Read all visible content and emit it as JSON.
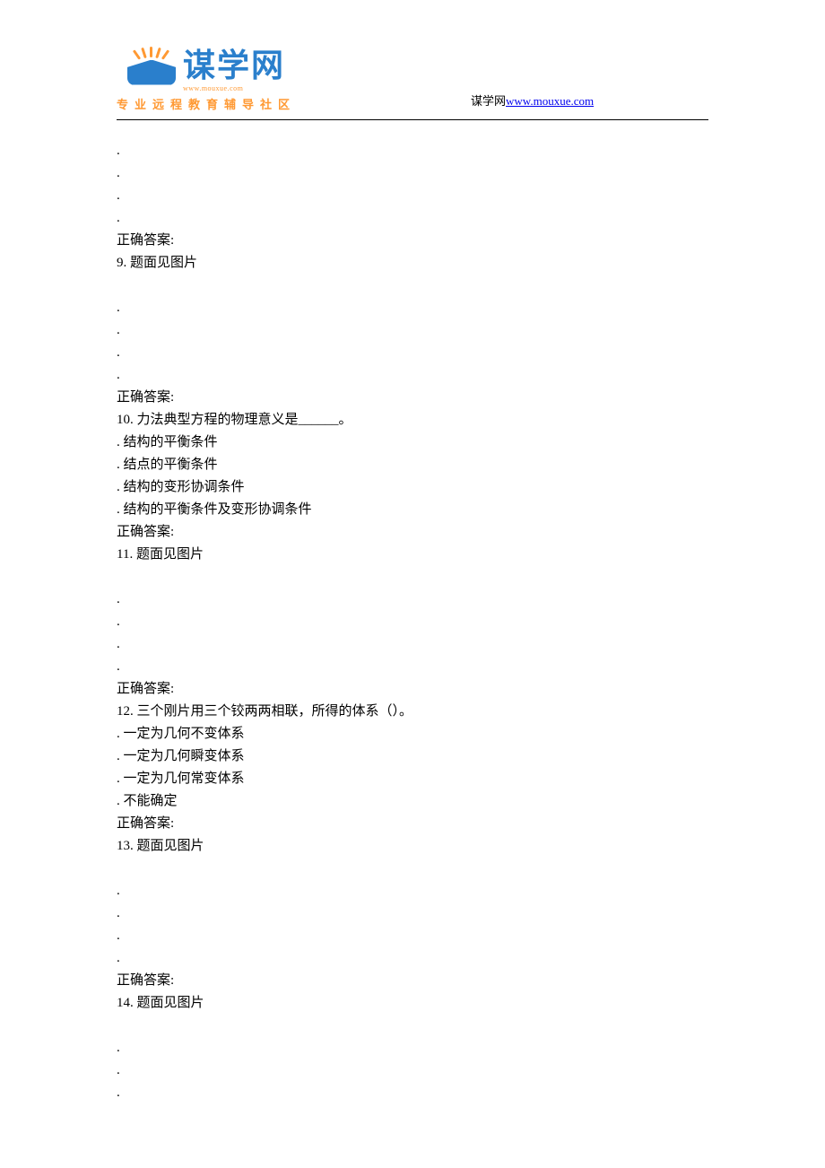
{
  "header": {
    "logo_text": "谋学网",
    "logo_url": "www.mouxue.com",
    "logo_subtitle": "专业远程教育辅导社区",
    "right_text": "谋学网",
    "right_link": "www.mouxue.com"
  },
  "items": [
    {
      "type": "dot",
      "text": "."
    },
    {
      "type": "dot",
      "text": "."
    },
    {
      "type": "dot",
      "text": "."
    },
    {
      "type": "dot",
      "text": "."
    },
    {
      "type": "answer",
      "text": "正确答案:"
    },
    {
      "type": "question",
      "text": "9.   题面见图片"
    },
    {
      "type": "blank",
      "text": ""
    },
    {
      "type": "dot",
      "text": "."
    },
    {
      "type": "dot",
      "text": "."
    },
    {
      "type": "dot",
      "text": "."
    },
    {
      "type": "dot",
      "text": "."
    },
    {
      "type": "answer",
      "text": "正确答案:"
    },
    {
      "type": "question",
      "text": "10.   力法典型方程的物理意义是______。"
    },
    {
      "type": "option",
      "text": ".  结构的平衡条件"
    },
    {
      "type": "option",
      "text": ".  结点的平衡条件"
    },
    {
      "type": "option",
      "text": ".  结构的变形协调条件"
    },
    {
      "type": "option",
      "text": ".  结构的平衡条件及变形协调条件"
    },
    {
      "type": "answer",
      "text": "正确答案:"
    },
    {
      "type": "question",
      "text": "11.   题面见图片"
    },
    {
      "type": "blank",
      "text": ""
    },
    {
      "type": "dot",
      "text": "."
    },
    {
      "type": "dot",
      "text": "."
    },
    {
      "type": "dot",
      "text": "."
    },
    {
      "type": "dot",
      "text": "."
    },
    {
      "type": "answer",
      "text": "正确答案:"
    },
    {
      "type": "question",
      "text": "12.   三个刚片用三个铰两两相联，所得的体系（）。"
    },
    {
      "type": "option",
      "text": ".  一定为几何不变体系"
    },
    {
      "type": "option",
      "text": ".  一定为几何瞬变体系"
    },
    {
      "type": "option",
      "text": ".  一定为几何常变体系"
    },
    {
      "type": "option",
      "text": ".  不能确定"
    },
    {
      "type": "answer",
      "text": "正确答案:"
    },
    {
      "type": "question",
      "text": "13.   题面见图片"
    },
    {
      "type": "blank",
      "text": ""
    },
    {
      "type": "dot",
      "text": "."
    },
    {
      "type": "dot",
      "text": "."
    },
    {
      "type": "dot",
      "text": "."
    },
    {
      "type": "dot",
      "text": "."
    },
    {
      "type": "answer",
      "text": "正确答案:"
    },
    {
      "type": "question",
      "text": "14.   题面见图片"
    },
    {
      "type": "blank",
      "text": ""
    },
    {
      "type": "dot",
      "text": "."
    },
    {
      "type": "dot",
      "text": "."
    },
    {
      "type": "dot",
      "text": "."
    }
  ]
}
